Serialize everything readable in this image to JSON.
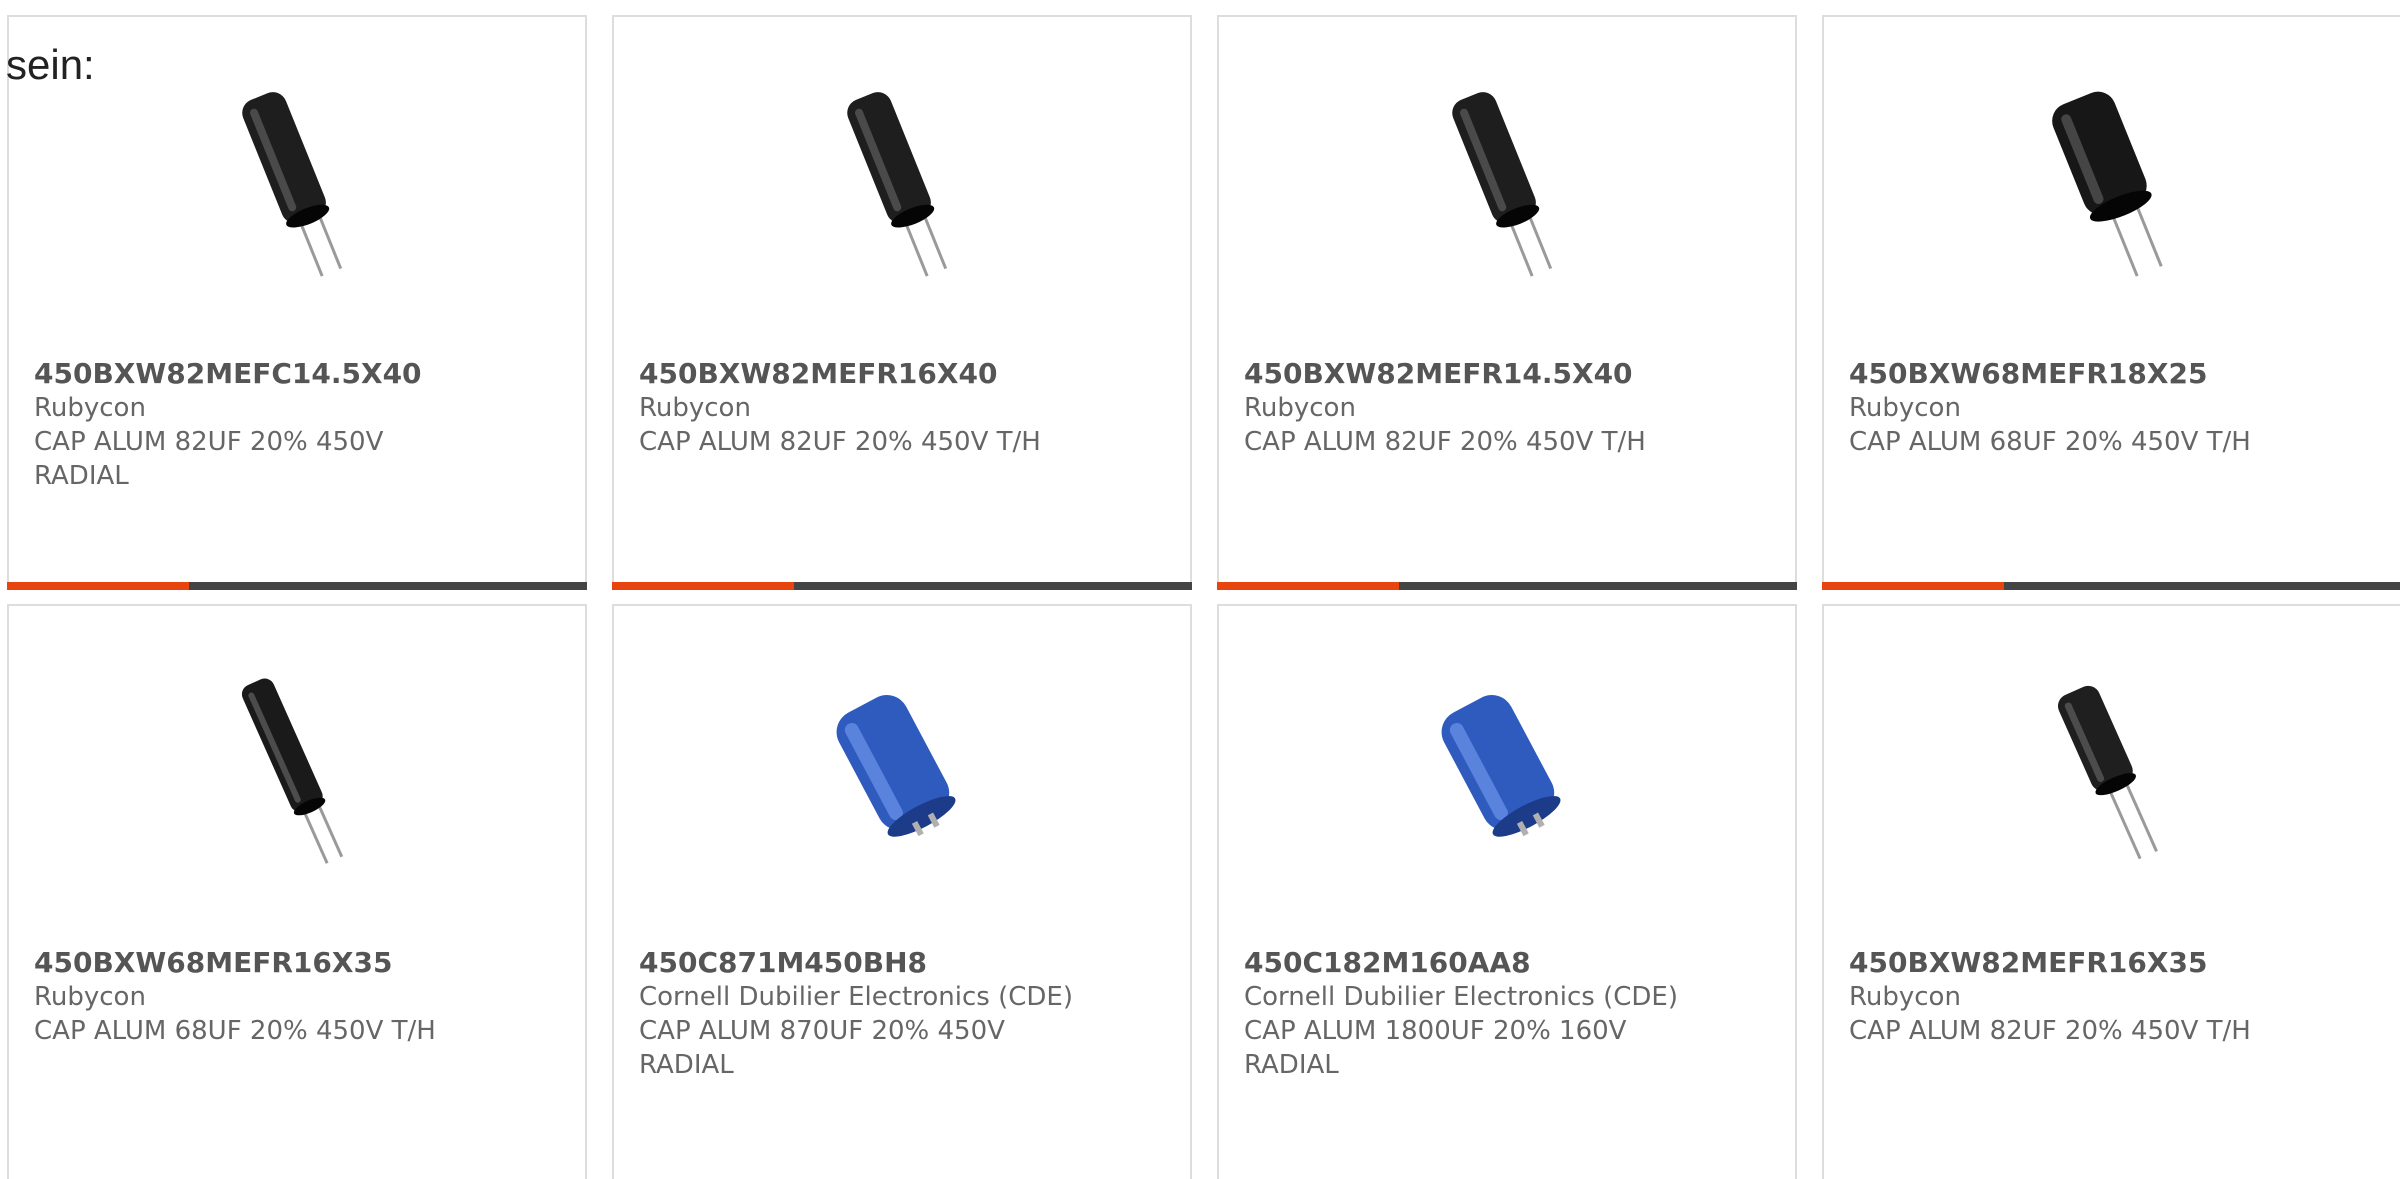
{
  "intro_text": "sein:",
  "colors": {
    "accent": "#e8440f",
    "bar_track": "#444444",
    "card_border": "#dddddd"
  },
  "products": [
    {
      "part_number": "450BXW82MEFC14.5X40",
      "manufacturer": "Rubycon",
      "description": "CAP ALUM 82UF 20% 450V\nRADIAL",
      "image": "black-capacitor-slim-icon"
    },
    {
      "part_number": "450BXW82MEFR16X40",
      "manufacturer": "Rubycon",
      "description": "CAP ALUM 82UF 20% 450V T/H",
      "image": "black-capacitor-slim-icon"
    },
    {
      "part_number": "450BXW82MEFR14.5X40",
      "manufacturer": "Rubycon",
      "description": "CAP ALUM 82UF 20% 450V T/H",
      "image": "black-capacitor-slim-icon"
    },
    {
      "part_number": "450BXW68MEFR18X25",
      "manufacturer": "Rubycon",
      "description": "CAP ALUM 68UF 20% 450V T/H",
      "image": "black-capacitor-wide-icon"
    },
    {
      "part_number": "450BXW68MEFR16X35",
      "manufacturer": "Rubycon",
      "description": "CAP ALUM 68UF 20% 450V T/H",
      "image": "black-capacitor-long-icon"
    },
    {
      "part_number": "450C871M450BH8",
      "manufacturer": "Cornell Dubilier Electronics (CDE)",
      "description": "CAP ALUM 870UF 20% 450V\nRADIAL",
      "image": "blue-capacitor-icon"
    },
    {
      "part_number": "450C182M160AA8",
      "manufacturer": "Cornell Dubilier Electronics (CDE)",
      "description": "CAP ALUM 1800UF 20% 160V\nRADIAL",
      "image": "blue-capacitor-icon"
    },
    {
      "part_number": "450BXW82MEFR16X35",
      "manufacturer": "Rubycon",
      "description": "CAP ALUM 82UF 20% 450V T/H",
      "image": "black-capacitor-small-icon"
    }
  ]
}
